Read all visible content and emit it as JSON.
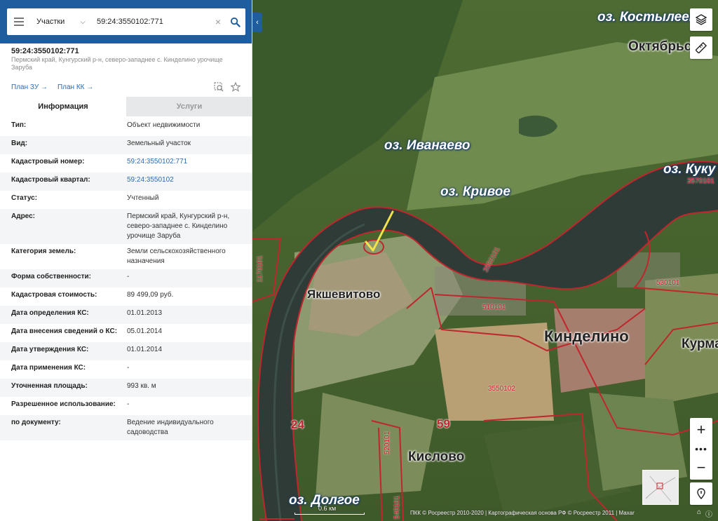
{
  "search": {
    "dropdown_label": "Участки",
    "value": "59:24:3550102:771"
  },
  "object": {
    "title": "59:24:3550102:771",
    "address_line": "Пермский край, Кунгурский р-н, северо-западнее с. Кинделино урочище Заруба",
    "plan_zu": "План ЗУ →",
    "plan_kk": "План КК →"
  },
  "tabs": {
    "info": "Информация",
    "services": "Услуги"
  },
  "rows": [
    {
      "label": "Тип:",
      "value": "Объект недвижимости"
    },
    {
      "label": "Вид:",
      "value": "Земельный участок"
    },
    {
      "label": "Кадастровый номер:",
      "value": "59:24:3550102:771"
    },
    {
      "label": "Кадастровый квартал:",
      "value": "59:24:3550102"
    },
    {
      "label": "Статус:",
      "value": "Учтенный"
    },
    {
      "label": "Адрес:",
      "value": "Пермский край, Кунгурский р-н, северо-западнее с. Кинделино урочище Заруба"
    },
    {
      "label": "Категория земель:",
      "value": "Земли сельскохозяйственного назначения"
    },
    {
      "label": "Форма собственности:",
      "value": "-"
    },
    {
      "label": "Кадастровая стоимость:",
      "value": "89 499,09 руб."
    },
    {
      "label": "Дата определения КС:",
      "value": "01.01.2013"
    },
    {
      "label": "Дата внесения сведений о КС:",
      "value": "05.01.2014"
    },
    {
      "label": "Дата утверждения КС:",
      "value": "01.01.2014"
    },
    {
      "label": "Дата применения КС:",
      "value": "-"
    },
    {
      "label": "Уточненная площадь:",
      "value": "993 кв. м"
    },
    {
      "label": "Разрешенное использование:",
      "value": "-"
    },
    {
      "label": "по документу:",
      "value": "Ведение индивидуального садоводства"
    }
  ],
  "map": {
    "lakes": {
      "kostyleevo": "оз. Костылеево",
      "ivanaevo": "оз. Иванаево",
      "krivoe": "оз. Кривое",
      "kuku": "оз. Куку",
      "dolgoe": "оз. Долгое"
    },
    "places": {
      "oktyabrsky": "Октябрьск",
      "yakshevitovo": "Якшевитово",
      "kindelino": "Кинделино",
      "kurma": "Курма",
      "kislovo": "Кислово"
    },
    "quarters": {
      "q3550101": "3550101",
      "q3570101": "3570101",
      "q530101": "530101",
      "q510101": "510101",
      "q3550102": "3550102",
      "q1170101": "1170101",
      "q520101": "520101",
      "q540101": "540101"
    },
    "district_24": "24",
    "region_59": "59",
    "scale_label": "0.6 км",
    "copyright": "ПКК © Росреестр 2010-2020 | Картографическая основа РФ © Росреестр 2011 | Maxar",
    "colors": {
      "boundary": "#c0262d",
      "panel_header": "#1f5d9e",
      "link": "#2b6cb0"
    }
  }
}
